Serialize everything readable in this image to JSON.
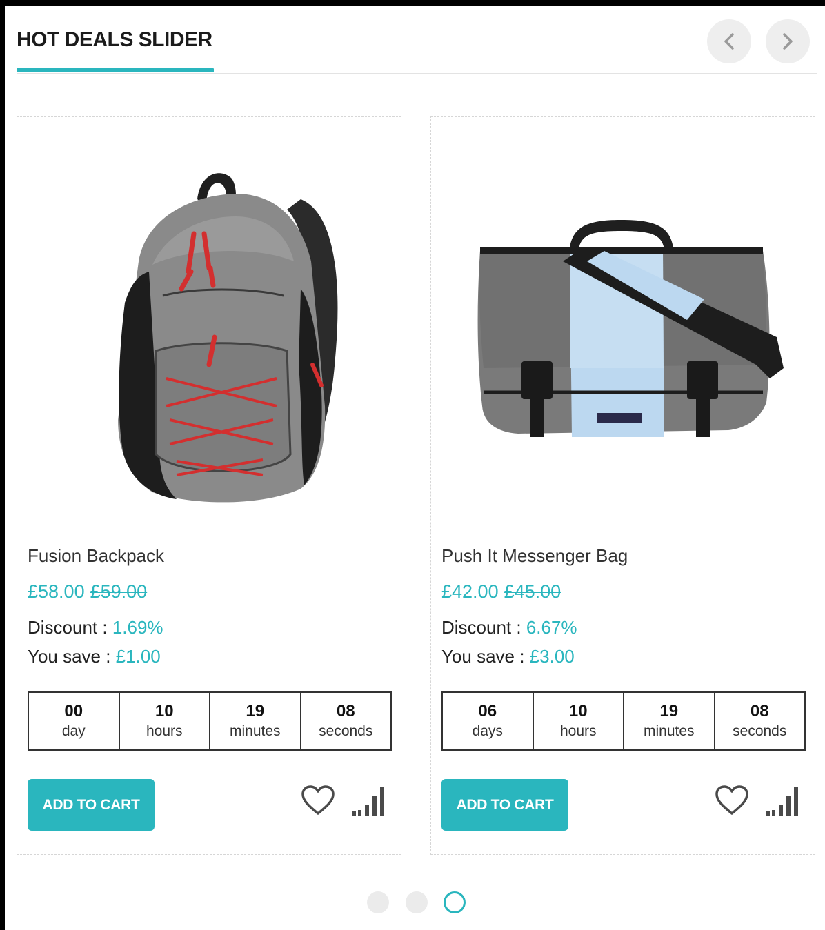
{
  "header": {
    "title": "HOT DEALS SLIDER"
  },
  "colors": {
    "accent": "#2ab6be",
    "nav_bg": "#eeeeee",
    "border": "#333333"
  },
  "products": [
    {
      "name": "Fusion Backpack",
      "image_icon": "backpack-image",
      "price_new": "£58.00",
      "price_old": "£59.00",
      "discount_label": "Discount : ",
      "discount_value": "1.69%",
      "save_label": "You save : ",
      "save_value": "£1.00",
      "countdown": [
        {
          "num": "00",
          "label": "day"
        },
        {
          "num": "10",
          "label": "hours"
        },
        {
          "num": "19",
          "label": "minutes"
        },
        {
          "num": "08",
          "label": "seconds"
        }
      ],
      "cart_label": "ADD TO CART"
    },
    {
      "name": "Push It Messenger Bag",
      "image_icon": "messenger-bag-image",
      "price_new": "£42.00",
      "price_old": "£45.00",
      "discount_label": "Discount : ",
      "discount_value": "6.67%",
      "save_label": "You save : ",
      "save_value": "£3.00",
      "countdown": [
        {
          "num": "06",
          "label": "days"
        },
        {
          "num": "10",
          "label": "hours"
        },
        {
          "num": "19",
          "label": "minutes"
        },
        {
          "num": "08",
          "label": "seconds"
        }
      ],
      "cart_label": "ADD TO CART"
    }
  ],
  "pagination": {
    "active_index": 3
  }
}
